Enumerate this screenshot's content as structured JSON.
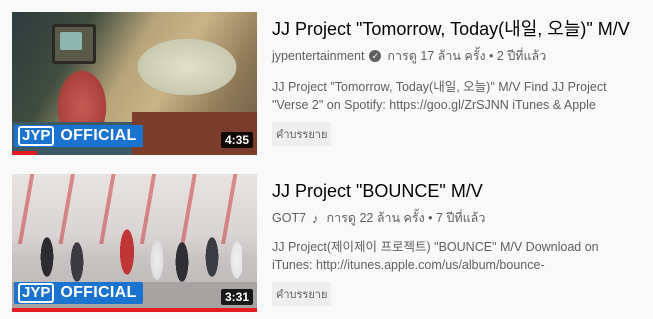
{
  "videos": [
    {
      "title": "JJ Project \"Tomorrow, Today(내일, 오늘)\" M/V",
      "channel": "jypentertainment",
      "channel_badge": "verified-icon",
      "views_age": "การดู 17 ล้าน ครั้ง • 2 ปีที่แล้ว",
      "description": "JJ Project \"Tomorrow, Today(내일, 오늘)\" M/V Find JJ Project \"Verse 2\" on Spotify: https://goo.gl/ZrSJNN iTunes & Apple",
      "chip": "คำบรรยาย",
      "duration": "4:35",
      "badge_logo": "JYP",
      "badge_text": "OFFICIAL",
      "watched_fraction": 0.1
    },
    {
      "title": "JJ Project \"BOUNCE\" M/V",
      "channel": "GOT7",
      "channel_badge": "music-note-icon",
      "views_age": "การดู 22 ล้าน ครั้ง • 7 ปีที่แล้ว",
      "description": "JJ Project(제이제이 프로젝트) \"BOUNCE\" M/V Download on iTunes: http://itunes.apple.com/us/album/bounce-",
      "chip": "คำบรรยาย",
      "duration": "3:31",
      "badge_logo": "JYP",
      "badge_text": "OFFICIAL",
      "watched_fraction": 1.0
    }
  ],
  "colors": {
    "background": "#f9f9f9",
    "title": "#030303",
    "meta": "#606060",
    "progress": "#e31b23",
    "badge": "#1b73d0"
  }
}
